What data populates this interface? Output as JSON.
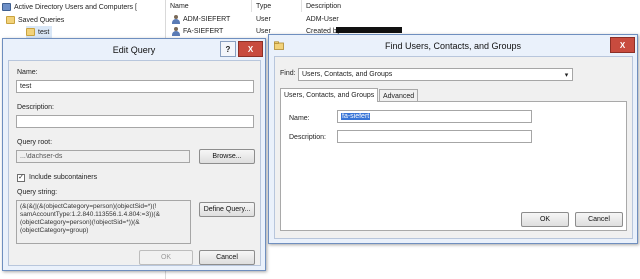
{
  "mmc": {
    "tree": {
      "root_label": "Active Directory Users and Computers [",
      "saved_queries_label": "Saved Queries",
      "test_label": "test"
    },
    "list": {
      "columns": [
        "Name",
        "Type",
        "Description"
      ],
      "rows": [
        {
          "name": "ADM-SIEFERT",
          "type": "User",
          "description": "ADM-User"
        },
        {
          "name": "FA-SIEFERT",
          "type": "User",
          "description": "Created by"
        }
      ]
    }
  },
  "edit_query": {
    "title": "Edit Query",
    "help_btn": "?",
    "close_btn": "X",
    "name_label": "Name:",
    "name_value": "test",
    "description_label": "Description:",
    "description_value": "",
    "query_root_label": "Query root:",
    "query_root_value": "...\\dachser-ds",
    "browse_btn": "Browse...",
    "include_subcontainers_label": "Include subcontainers",
    "include_subcontainers_checked": true,
    "check_mark": "✓",
    "query_string_label": "Query string:",
    "query_string_value": "(&(&(|(&(objectCategory=person)(objectSid=*)(!\nsamAccountType:1.2.840.113556.1.4.804:=3))(&\n(objectCategory=person)(!objectSid=*))(&\n(objectCategory=group)",
    "define_query_btn": "Define Query...",
    "ok_btn": "OK",
    "cancel_btn": "Cancel"
  },
  "find": {
    "title": "Find Users, Contacts, and Groups",
    "find_label": "Find:",
    "find_value": "Users, Contacts, and Groups",
    "combo_arrow": "▾",
    "tabs": [
      "Users, Contacts, and Groups",
      "Advanced"
    ],
    "name_label": "Name:",
    "name_value": "fa-siefert",
    "description_label": "Description:",
    "description_value": "",
    "ok_btn": "OK",
    "cancel_btn": "Cancel"
  }
}
